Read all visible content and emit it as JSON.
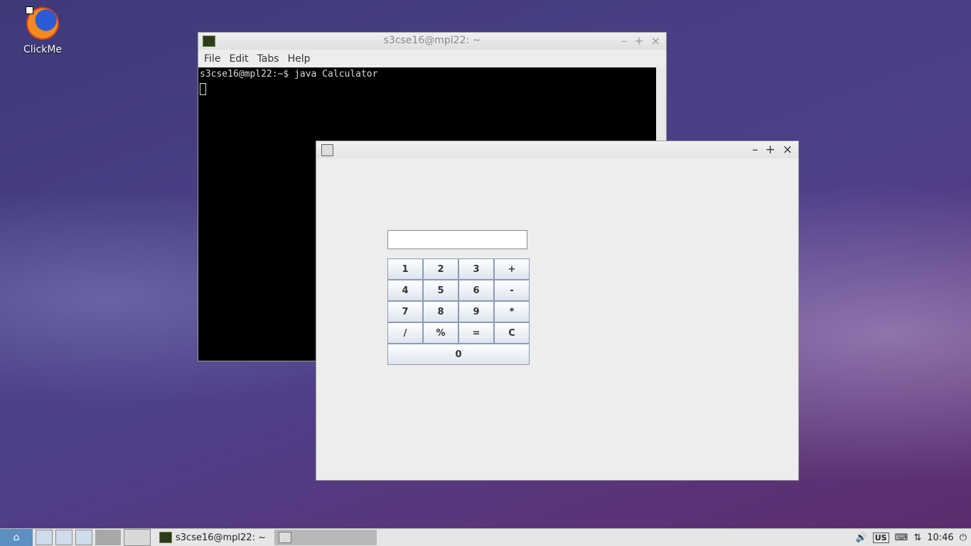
{
  "desktop": {
    "icon_label": "ClickMe",
    "icon_name": "firefox-icon"
  },
  "terminal": {
    "title": "s3cse16@mpl22: ~",
    "controls": {
      "minimize": "–",
      "maximize": "+",
      "close": "×"
    },
    "menu": [
      "File",
      "Edit",
      "Tabs",
      "Help"
    ],
    "lines": [
      "s3cse16@mpl22:~$ java Calculator"
    ]
  },
  "calculator": {
    "title": "",
    "controls": {
      "minimize": "–",
      "maximize": "+",
      "close": "×"
    },
    "display_value": "",
    "keys": [
      "1",
      "2",
      "3",
      "+",
      "4",
      "5",
      "6",
      "-",
      "7",
      "8",
      "9",
      "*",
      "/",
      "%",
      "=",
      "C",
      "0"
    ]
  },
  "taskbar": {
    "tasks": [
      {
        "label": "s3cse16@mpl22: ~",
        "icon": "terminal-icon"
      },
      {
        "label": "",
        "icon": "java-icon"
      }
    ],
    "keyboard_layout": "US",
    "clock": "10:46"
  }
}
